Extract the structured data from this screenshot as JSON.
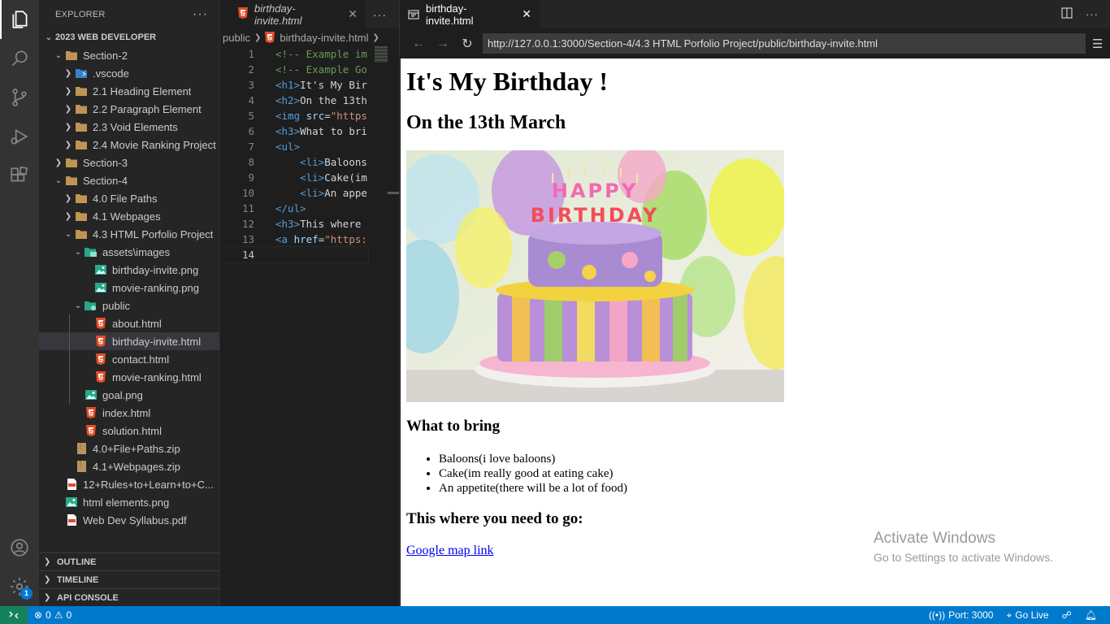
{
  "explorer": {
    "title": "EXPLORER",
    "more": "···",
    "root": "2023 WEB DEVELOPER",
    "items": [
      {
        "label": "Section-2"
      },
      {
        "label": ".vscode"
      },
      {
        "label": "2.1 Heading Element"
      },
      {
        "label": "2.2 Paragraph Element"
      },
      {
        "label": "2.3 Void Elements"
      },
      {
        "label": "2.4 Movie Ranking Project"
      },
      {
        "label": "Section-3"
      },
      {
        "label": "Section-4"
      },
      {
        "label": "4.0 File Paths"
      },
      {
        "label": "4.1 Webpages"
      },
      {
        "label": "4.3 HTML Porfolio Project"
      },
      {
        "label": "assets\\images"
      },
      {
        "label": "birthday-invite.png"
      },
      {
        "label": "movie-ranking.png"
      },
      {
        "label": "public"
      },
      {
        "label": "about.html"
      },
      {
        "label": "birthday-invite.html"
      },
      {
        "label": "contact.html"
      },
      {
        "label": "movie-ranking.html"
      },
      {
        "label": "goal.png"
      },
      {
        "label": "index.html"
      },
      {
        "label": "solution.html"
      },
      {
        "label": "4.0+File+Paths.zip"
      },
      {
        "label": "4.1+Webpages.zip"
      },
      {
        "label": "12+Rules+to+Learn+to+C..."
      },
      {
        "label": "html elements.png"
      },
      {
        "label": "Web Dev Syllabus.pdf"
      }
    ],
    "sections": [
      "OUTLINE",
      "TIMELINE",
      "API CONSOLE"
    ]
  },
  "activity": {
    "accounts_badge": "1"
  },
  "editor": {
    "tab": "birthday-invite.html",
    "more": "···",
    "breadcrumb": [
      "public",
      "birthday-invite.html"
    ],
    "lines": [
      {
        "n": "1",
        "html": "<span class='cm'>&lt;!-- Example im</span>"
      },
      {
        "n": "2",
        "html": "<span class='cm'>&lt;!-- Example Go</span>"
      },
      {
        "n": "3",
        "html": "<span class='tg'>&lt;h1&gt;</span><span class='tx'>It's My Bir</span>"
      },
      {
        "n": "4",
        "html": "<span class='tg'>&lt;h2&gt;</span><span class='tx'>On the 13th</span>"
      },
      {
        "n": "5",
        "html": "<span class='tg'>&lt;img</span> <span class='at'>src</span><span class='tx'>=</span><span class='st'>\"https</span>"
      },
      {
        "n": "6",
        "html": "<span class='tg'>&lt;h3&gt;</span><span class='tx'>What to bri</span>"
      },
      {
        "n": "7",
        "html": "<span class='tg'>&lt;ul&gt;</span>"
      },
      {
        "n": "8",
        "html": "    <span class='tg'>&lt;li&gt;</span><span class='tx'>Baloons</span>"
      },
      {
        "n": "9",
        "html": "    <span class='tg'>&lt;li&gt;</span><span class='tx'>Cake(im</span>"
      },
      {
        "n": "10",
        "html": "    <span class='tg'>&lt;li&gt;</span><span class='tx'>An appe</span>"
      },
      {
        "n": "11",
        "html": "<span class='tg'>&lt;/ul&gt;</span>"
      },
      {
        "n": "12",
        "html": "<span class='tg'>&lt;h3&gt;</span><span class='tx'>This where</span>"
      },
      {
        "n": "13",
        "html": "<span class='tg'>&lt;a</span> <span class='at'>href</span><span class='tx'>=</span><span class='st'>\"https:</span>"
      },
      {
        "n": "14",
        "html": ""
      }
    ]
  },
  "browser": {
    "tab": "birthday-invite.html",
    "url": "http://127.0.0.1:3000/Section-4/4.3 HTML Porfolio Project/public/birthday-invite.html",
    "page": {
      "h1": "It's My Birthday !",
      "h2": "On the 13th March",
      "cake_text": "HAPPY BIRTHDAY",
      "h3_bring": "What to bring",
      "bring_items": [
        "Baloons(i love baloons)",
        "Cake(im really good at eating cake)",
        "An appetite(there will be a lot of food)"
      ],
      "h3_where": "This where you need to go:",
      "link": "Google map link"
    },
    "watermark": {
      "line1": "Activate Windows",
      "line2": "Go to Settings to activate Windows."
    }
  },
  "statusbar": {
    "errors": "0",
    "warnings": "0",
    "port": "Port: 3000",
    "golive": "Go Live"
  },
  "colors": {
    "statusbar": "#007acc",
    "remote": "#16825d",
    "html_icon": "#e44d26",
    "folder": "#c09553"
  }
}
